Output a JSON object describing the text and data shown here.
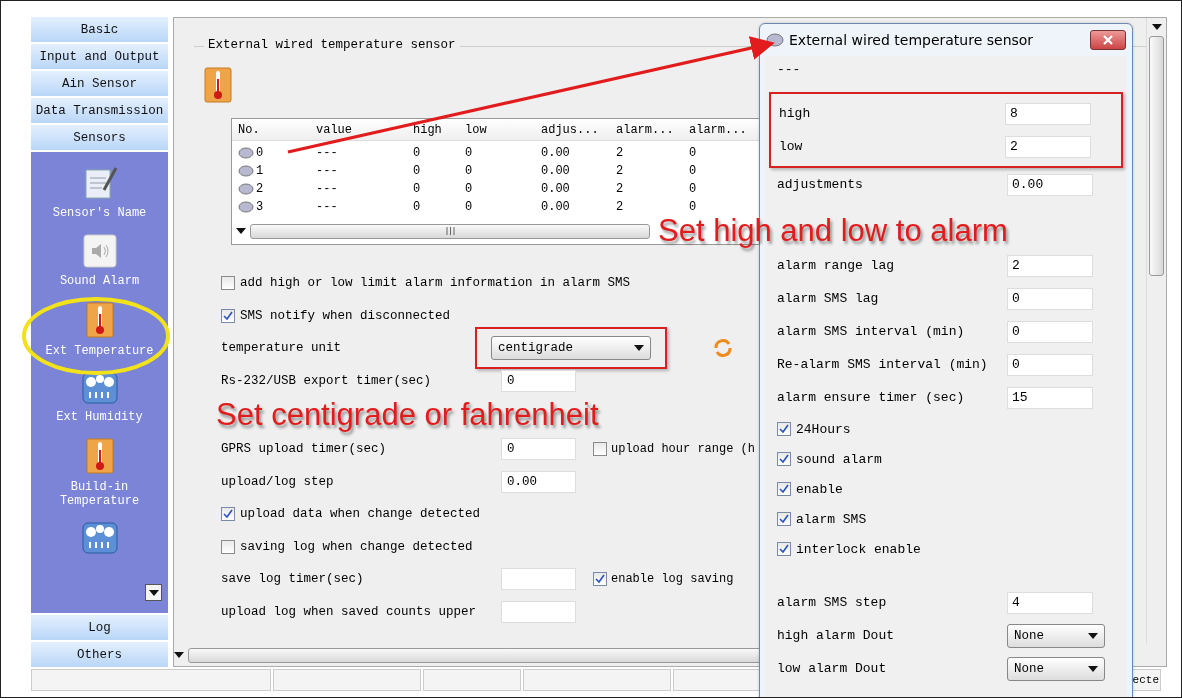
{
  "sidebar": {
    "sections_top": [
      {
        "label": "Basic"
      },
      {
        "label": "Input and Output"
      },
      {
        "label": "Ain Sensor"
      },
      {
        "label": "Data Transmission"
      },
      {
        "label": "Sensors"
      }
    ],
    "items": [
      {
        "kind": "notepad",
        "label": "Sensor's Name"
      },
      {
        "kind": "speaker",
        "label": "Sound Alarm"
      },
      {
        "kind": "thermometer",
        "label": "Ext Temperature"
      },
      {
        "kind": "gauge",
        "label": "Ext Humidity"
      },
      {
        "kind": "thermometer",
        "label": "Build-in Temperature"
      },
      {
        "kind": "gauge"
      }
    ],
    "sections_bottom": [
      {
        "label": "Log"
      },
      {
        "label": "Others"
      }
    ]
  },
  "panel": {
    "title": "External wired temperature sensor",
    "table": {
      "columns": [
        "No.",
        "value",
        "high",
        "low",
        "adjus...",
        "alarm...",
        "alarm..."
      ],
      "rows": [
        [
          "0",
          "---",
          "0",
          "0",
          "0.00",
          "2",
          "0"
        ],
        [
          "1",
          "---",
          "0",
          "0",
          "0.00",
          "2",
          "0"
        ],
        [
          "2",
          "---",
          "0",
          "0",
          "0.00",
          "2",
          "0"
        ],
        [
          "3",
          "---",
          "0",
          "0",
          "0.00",
          "2",
          "0"
        ]
      ]
    },
    "form": [
      {
        "kind": "checkbox",
        "label": "add high or low limit alarm information in alarm SMS",
        "checked": false
      },
      {
        "kind": "checkbox",
        "label": "SMS notify when disconnected",
        "checked": true
      },
      {
        "kind": "select",
        "label": "temperature unit",
        "value": "centigrade"
      },
      {
        "kind": "field",
        "label": "Rs-232/USB export timer(sec)",
        "value": "0"
      },
      {
        "kind": "field",
        "label": "GPRS upload timer(sec)",
        "value": "0",
        "extra": {
          "label": "upload hour range (h",
          "checked": false
        }
      },
      {
        "kind": "field",
        "label": "upload/log step",
        "value": "0.00"
      },
      {
        "kind": "checkbox",
        "label": "upload data when change detected",
        "checked": true
      },
      {
        "kind": "checkbox",
        "label": "saving log when change detected",
        "checked": false
      },
      {
        "kind": "field",
        "label": "save log timer(sec)",
        "extra": {
          "label": "enable log saving",
          "checked": true
        }
      },
      {
        "kind": "field",
        "label": "upload log when saved counts upper"
      }
    ]
  },
  "status_bar": {
    "text": "ecte"
  },
  "dialog": {
    "title": "External wired temperature sensor",
    "reading": "---",
    "fields": [
      {
        "kind": "field",
        "label": "high",
        "value": "8"
      },
      {
        "kind": "field",
        "label": "low",
        "value": "2"
      },
      {
        "kind": "field",
        "label": "adjustments",
        "value": "0.00"
      },
      {
        "kind": "field",
        "label": "alarm range lag",
        "value": "2"
      },
      {
        "kind": "field",
        "label": "alarm SMS lag",
        "value": "0"
      },
      {
        "kind": "field",
        "label": "alarm SMS interval (min)",
        "value": "0"
      },
      {
        "kind": "field",
        "label": "Re-alarm SMS interval (min)",
        "value": "0"
      },
      {
        "kind": "field",
        "label": "alarm ensure timer (sec)",
        "value": "15"
      }
    ],
    "checkboxes": [
      {
        "label": "24Hours",
        "checked": true
      },
      {
        "label": "sound alarm",
        "checked": true
      },
      {
        "label": "enable",
        "checked": true
      },
      {
        "label": "alarm SMS",
        "checked": true
      },
      {
        "label": "interlock enable",
        "checked": true
      }
    ],
    "lower_fields": [
      {
        "kind": "field",
        "label": "alarm SMS step",
        "value": "4"
      },
      {
        "kind": "select",
        "label": "high alarm Dout",
        "value": "None"
      },
      {
        "kind": "select",
        "label": "low alarm Dout",
        "value": "None"
      }
    ]
  },
  "annotations": [
    {
      "text": "Set high and low to alarm"
    },
    {
      "text": "Set centigrade or fahrenheit"
    }
  ]
}
